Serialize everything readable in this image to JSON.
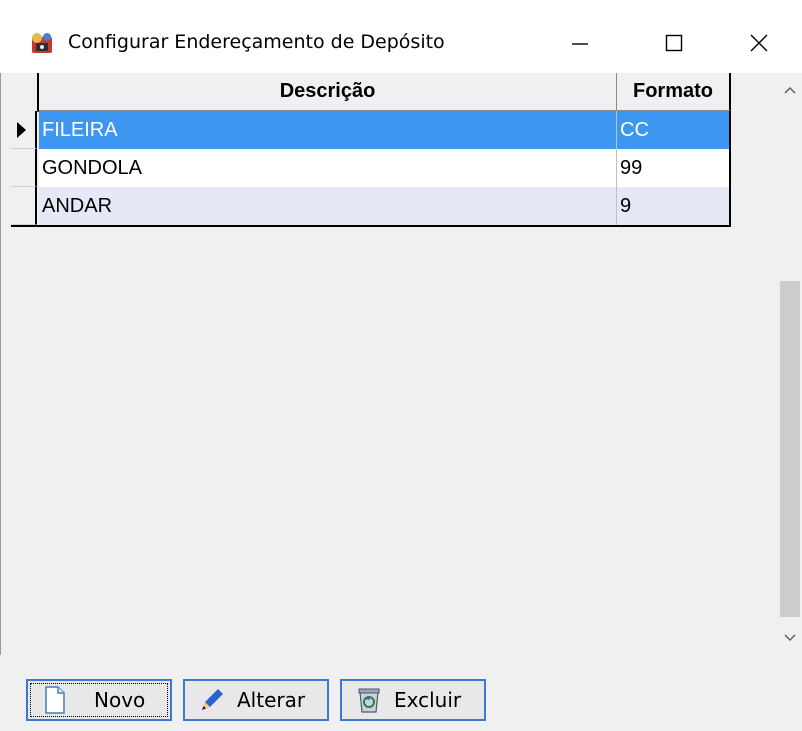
{
  "window": {
    "title": "Configurar Endereçamento de Depósito",
    "controls": {
      "minimize": "—",
      "maximize": "☐",
      "close": "✕"
    }
  },
  "grid": {
    "columns": [
      "Descrição",
      "Formato"
    ],
    "rows": [
      {
        "descricao": "FILEIRA",
        "formato": "CC",
        "selected": true
      },
      {
        "descricao": "GONDOLA",
        "formato": "99",
        "selected": false
      },
      {
        "descricao": "ANDAR",
        "formato": "9",
        "selected": false
      }
    ],
    "selection_color": "#3d97f0",
    "alt_row_color": "#e4e9f5"
  },
  "buttons": {
    "novo": {
      "label": "Novo",
      "icon": "new-document-icon"
    },
    "alterar": {
      "label": "Alterar",
      "icon": "pen-icon"
    },
    "excluir": {
      "label": "Excluir",
      "icon": "recycle-bin-icon"
    }
  }
}
